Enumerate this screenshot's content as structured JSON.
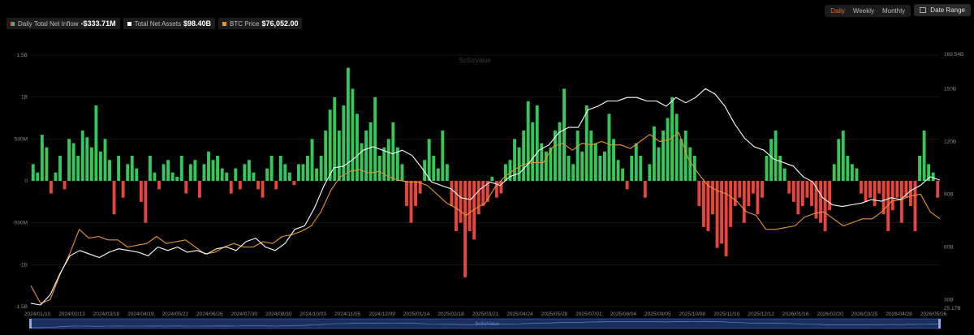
{
  "legend": {
    "inflow": {
      "label": "Daily Total Net Inflow",
      "value": "-$333.71M"
    },
    "assets": {
      "label": "Total Net Assets",
      "value": "$98.40B"
    },
    "btc": {
      "label": "BTC Price",
      "value": "$76,052.00"
    }
  },
  "timeframes": [
    "Daily",
    "Weekly",
    "Monthly"
  ],
  "active_timeframe": "Daily",
  "date_range_label": "Date Range",
  "watermark": "SoSoValue",
  "colors": {
    "inflow_pos": "#34c759",
    "inflow_neg": "#e8463d",
    "assets": "#ffffff",
    "btc": "#e9952e",
    "grid": "#1f1f1f"
  },
  "chart_data": {
    "type": "bar",
    "x_ticks": [
      "2024/01/10",
      "2024/02/13",
      "2024/03/18",
      "2024/04/19",
      "2024/05/22",
      "2024/06/26",
      "2024/07/30",
      "2024/08/30",
      "2024/10/03",
      "2024/11/05",
      "2024/12/09",
      "2025/01/14",
      "2025/02/18",
      "2025/03/21",
      "2025/04/24",
      "2025/05/28",
      "2025/07/01",
      "2025/08/04",
      "2025/09/05",
      "2025/10/08",
      "2025/11/10",
      "2025/12/12",
      "2026/01/16",
      "2026/02/20",
      "2026/03/25",
      "2026/04/28",
      "2026/05/26"
    ],
    "left_axis": {
      "ticks": [
        "1.5B",
        "1B",
        "500M",
        "0",
        "-500M",
        "-1B",
        "-1.5B"
      ],
      "values": [
        1.5,
        1,
        0.5,
        0,
        -0.5,
        -1,
        -1.5
      ],
      "unit": "B"
    },
    "right_axis": {
      "ticks": [
        "169.54B",
        "150B",
        "120B",
        "90B",
        "60B",
        "30B",
        "25.17B"
      ],
      "values": [
        169.54,
        150,
        120,
        90,
        60,
        30,
        25.17
      ],
      "unit": "B"
    },
    "series": [
      {
        "name": "Daily Total Net Inflow",
        "axis": "left",
        "type": "bar",
        "values": [
          0.2,
          0.1,
          0.55,
          0.4,
          -0.15,
          0.1,
          0.3,
          -0.1,
          0.5,
          0.45,
          0.3,
          0.6,
          0.52,
          0.4,
          0.9,
          0.35,
          0.5,
          0.25,
          -0.4,
          0.3,
          -0.2,
          0.2,
          0.3,
          0.15,
          -0.25,
          -0.5,
          0.3,
          0.1,
          -0.1,
          0.2,
          0.25,
          0.1,
          0.05,
          0.3,
          -0.15,
          0.2,
          0.25,
          -0.2,
          0.2,
          0.35,
          0.25,
          0.3,
          0.15,
          0.1,
          -0.15,
          0.15,
          -0.1,
          0.2,
          0.25,
          0.1,
          -0.1,
          -0.2,
          0.15,
          0.3,
          -0.1,
          0.3,
          0.2,
          0.1,
          -0.05,
          0.2,
          0.2,
          0.3,
          0.5,
          0.15,
          0.3,
          0.6,
          0.85,
          1.0,
          0.6,
          0.9,
          1.35,
          1.1,
          0.8,
          0.45,
          0.6,
          0.7,
          1.0,
          0.3,
          0.4,
          0.5,
          0.7,
          0.4,
          0.2,
          -0.3,
          -0.5,
          -0.3,
          -0.15,
          0.25,
          0.5,
          0.3,
          0.15,
          0.6,
          0.2,
          -0.3,
          -0.6,
          -0.5,
          -1.15,
          -0.6,
          -0.7,
          -0.4,
          -0.3,
          -0.25,
          0.05,
          -0.2,
          -0.15,
          0.2,
          0.25,
          0.5,
          0.4,
          0.6,
          0.95,
          0.7,
          0.9,
          0.45,
          0.35,
          0.4,
          0.6,
          0.7,
          1.1,
          0.3,
          0.2,
          0.6,
          0.35,
          0.9,
          0.6,
          0.45,
          0.3,
          0.35,
          0.8,
          0.5,
          0.25,
          0.15,
          -0.1,
          0.3,
          0.45,
          0.3,
          -0.2,
          0.2,
          0.65,
          0.4,
          0.6,
          0.75,
          1.0,
          0.8,
          0.5,
          0.6,
          0.4,
          0.3,
          -0.3,
          -0.55,
          -0.6,
          -0.4,
          -0.8,
          -0.75,
          -0.9,
          -0.55,
          -0.3,
          -0.2,
          -0.5,
          -0.3,
          -0.15,
          -0.4,
          -0.2,
          0.3,
          0.5,
          0.6,
          0.3,
          0.15,
          -0.15,
          -0.25,
          -0.4,
          -0.3,
          -0.2,
          -0.3,
          -0.45,
          -0.5,
          -0.6,
          -0.35,
          0.2,
          0.5,
          0.6,
          0.3,
          0.2,
          0.15,
          -0.15,
          -0.25,
          -0.2,
          -0.3,
          -0.15,
          -0.4,
          -0.6,
          -0.35,
          -0.2,
          -0.5,
          -0.2,
          -0.3,
          -0.6,
          0.3,
          0.6,
          0.2,
          0.1,
          -0.2
        ],
        "note": "approximate inflows in billions USD across the visible period"
      },
      {
        "name": "Total Net Assets",
        "axis": "right",
        "type": "line",
        "values": [
          28,
          27,
          33,
          45,
          55,
          58,
          56,
          54,
          57,
          59,
          58,
          57,
          55,
          60,
          58,
          60,
          57,
          58,
          56,
          59,
          60,
          58,
          63,
          65,
          60,
          58,
          62,
          70,
          72,
          82,
          95,
          105,
          106,
          110,
          115,
          117,
          115,
          113,
          115,
          112,
          105,
          97,
          95,
          93,
          88,
          87,
          93,
          97,
          95,
          100,
          102,
          108,
          115,
          118,
          125,
          128,
          128,
          138,
          140,
          143,
          143,
          145,
          145,
          143,
          143,
          140,
          145,
          142,
          145,
          150,
          147,
          140,
          130,
          122,
          117,
          115,
          110,
          108,
          106,
          100,
          97,
          88,
          84,
          83,
          84,
          85,
          87,
          86,
          88,
          87,
          92,
          95,
          100,
          98
        ]
      },
      {
        "name": "BTC Price",
        "axis": "right",
        "type": "line",
        "values": [
          38,
          28,
          30,
          44,
          56,
          70,
          65,
          66,
          64,
          64,
          60,
          61,
          62,
          66,
          62,
          63,
          64,
          60,
          56,
          57,
          60,
          62,
          60,
          60,
          63,
          62,
          66,
          67,
          69,
          72,
          80,
          92,
          100,
          103,
          104,
          102,
          103,
          100,
          98,
          97,
          97,
          95,
          90,
          85,
          82,
          78,
          82,
          85,
          94,
          100,
          104,
          107,
          108,
          108,
          117,
          119,
          115,
          119,
          118,
          120,
          118,
          118,
          116,
          120,
          124,
          120,
          121,
          125,
          110,
          102,
          95,
          92,
          90,
          86,
          80,
          78,
          70,
          70,
          71,
          72,
          77,
          79,
          80,
          76,
          72,
          74,
          76,
          76,
          80,
          86,
          87,
          89,
          90,
          80,
          76
        ]
      }
    ],
    "grid": true,
    "legend_position": "top-left"
  }
}
